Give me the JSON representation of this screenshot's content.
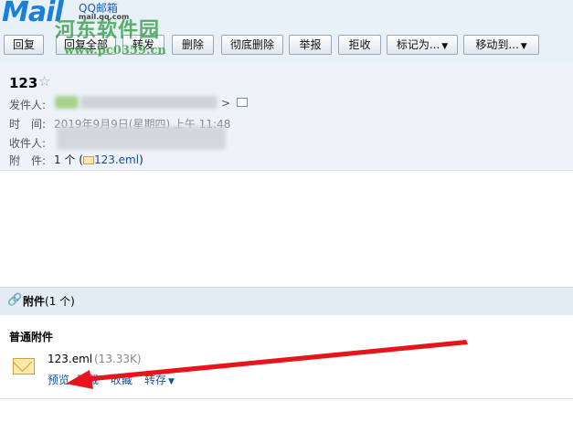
{
  "brand": {
    "logo": "Mail",
    "product": "QQ邮箱",
    "domain": "mail.qq.com"
  },
  "watermark": {
    "name": "河东软件园",
    "url": "www.pc0359.cn"
  },
  "toolbar": {
    "reply": "回复",
    "reply_all": "回复全部",
    "forward": "转发",
    "delete": "删除",
    "delete_permanent": "彻底删除",
    "report": "举报",
    "reject": "拒收",
    "mark_as": "标记为...",
    "move_to": "移动到..."
  },
  "mail": {
    "subject": "123",
    "star_glyph": "☆",
    "from_label": "发件人:",
    "time_label": "时　间:",
    "time_value": "2019年9月9日(星期四) 上午 11:48",
    "to_label": "收件人:",
    "attachment_label": "附　件:",
    "attachment_count": "1 个 (",
    "attachment_name": "123.eml",
    "attachment_close": ")"
  },
  "attachments": {
    "header": "附件",
    "header_count": "(1 个)",
    "section": "普通附件",
    "file_name": "123.eml",
    "file_size": "(13.33K)",
    "preview": "预览",
    "download": "下载",
    "collect": "收藏",
    "forward": "转存"
  },
  "colors": {
    "accent": "#1a4fa0",
    "arrow": "#e8141c",
    "header_bg": "#eef3fa"
  }
}
